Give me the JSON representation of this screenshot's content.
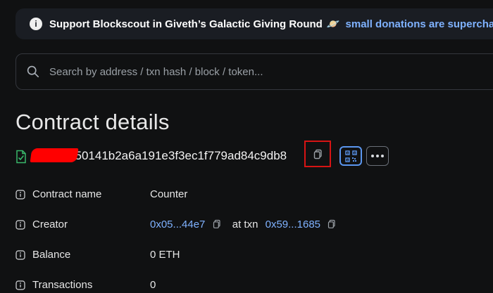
{
  "banner": {
    "text": "Support Blockscout in Giveth’s Galactic Giving Round",
    "emoji": "🪐",
    "link_text": "small donations are supercharged"
  },
  "search": {
    "placeholder": "Search by address / txn hash / block / token..."
  },
  "page": {
    "title": "Contract details"
  },
  "address": {
    "value": "0x85b4f50141b2a6a191e3f3ec1f779ad84c9db8"
  },
  "details": [
    {
      "label": "Contract name",
      "value": "Counter"
    },
    {
      "label": "Creator",
      "creator_address": "0x05...44e7",
      "txn_prefix": "at txn",
      "txn_hash": "0x59...1685"
    },
    {
      "label": "Balance",
      "value": "0 ETH"
    },
    {
      "label": "Transactions",
      "value": "0"
    }
  ],
  "colors": {
    "background": "#101112",
    "banner": "#1a1d23",
    "link": "#7fb2ff",
    "qr_accent": "#5b96ef",
    "contract_icon": "#39b86b",
    "highlight": "#d71414",
    "redaction": "#ff0000"
  },
  "icons": {
    "info": "info-icon",
    "search": "search-icon",
    "contract": "contract-icon",
    "copy": "copy-icon",
    "qr": "qr-code-icon",
    "more": "more-horizontal-icon"
  }
}
